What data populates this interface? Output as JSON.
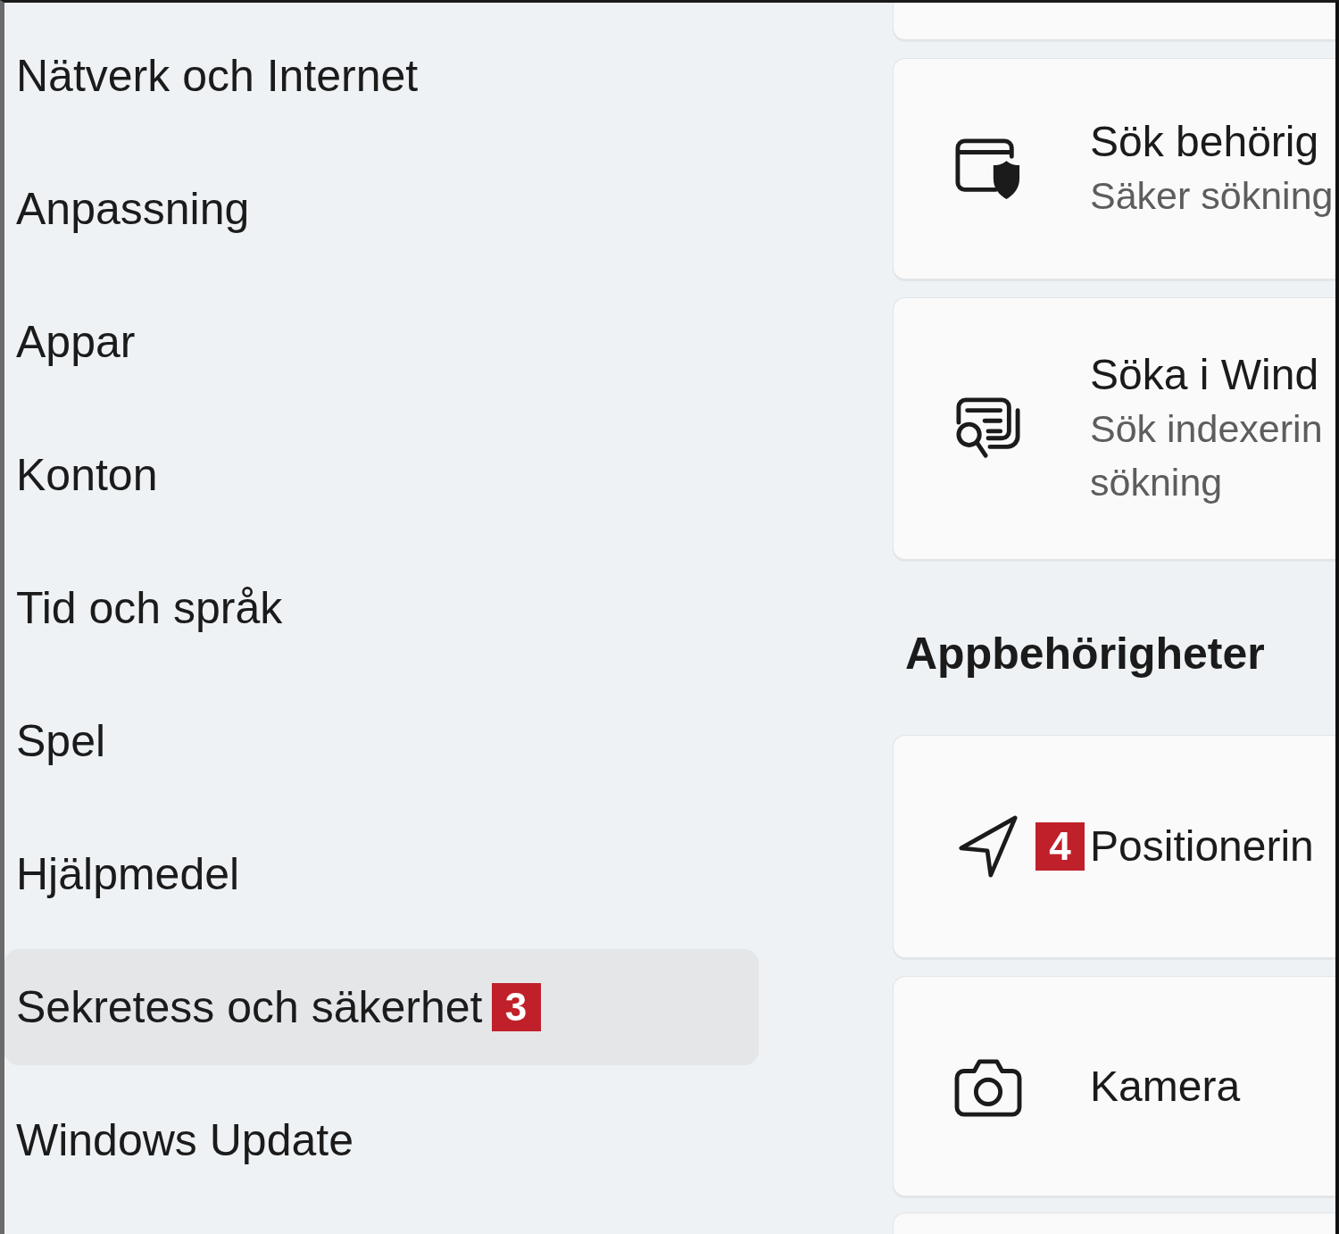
{
  "sidebar": {
    "items": [
      {
        "label": "Nätverk och Internet",
        "selected": false
      },
      {
        "label": "Anpassning",
        "selected": false
      },
      {
        "label": "Appar",
        "selected": false
      },
      {
        "label": "Konton",
        "selected": false
      },
      {
        "label": "Tid och språk",
        "selected": false
      },
      {
        "label": "Spel",
        "selected": false
      },
      {
        "label": "Hjälpmedel",
        "selected": false
      },
      {
        "label": "Sekretess och säkerhet",
        "selected": true,
        "badge": "3"
      },
      {
        "label": "Windows Update",
        "selected": false
      }
    ]
  },
  "main": {
    "sections": [
      {
        "cards": [
          {
            "title": "Sök behörig",
            "subtitle_lines": [
              "Säker sökning"
            ]
          },
          {
            "title": "Söka i Wind",
            "subtitle_lines": [
              "Sök indexerin",
              "sökning"
            ]
          }
        ]
      },
      {
        "heading": "Appbehörigheter",
        "cards": [
          {
            "title": "Positionerin",
            "badge": "4"
          },
          {
            "title": "Kamera"
          }
        ]
      }
    ]
  }
}
